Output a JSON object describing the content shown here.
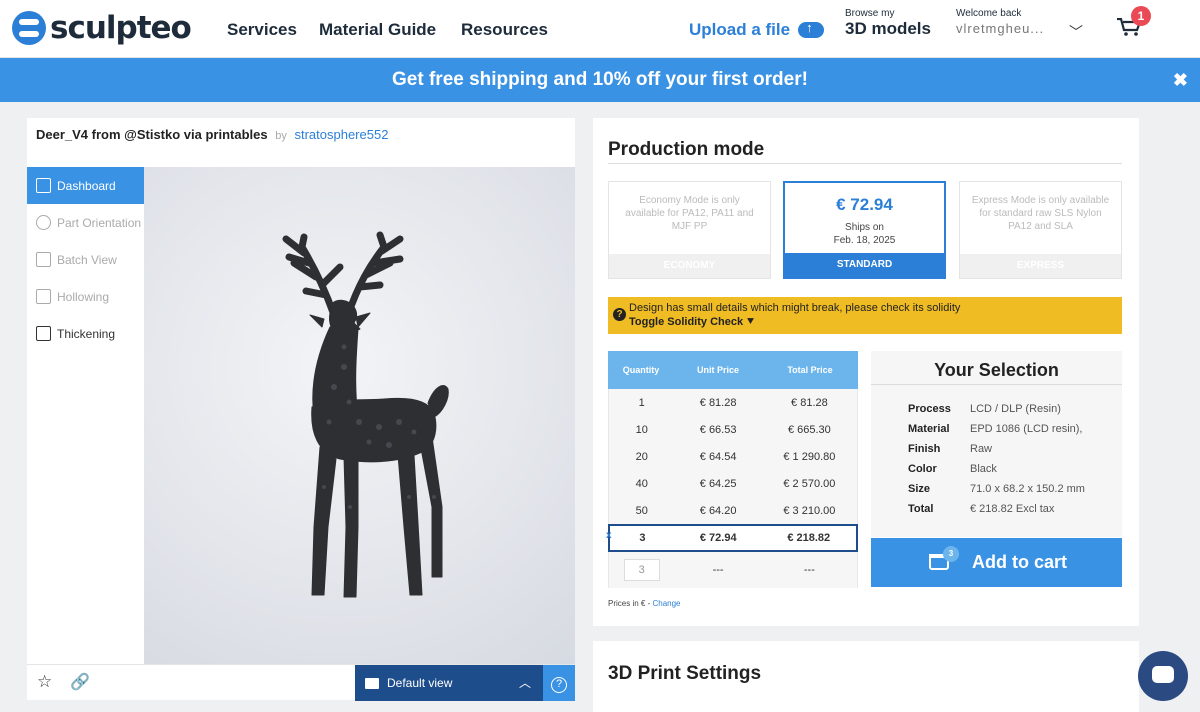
{
  "header": {
    "logo": "sculpteo",
    "nav": [
      "Services",
      "Material Guide",
      "Resources"
    ],
    "upload_label": "Upload a file",
    "browse_small": "Browse my",
    "browse_big": "3D models",
    "welcome_small": "Welcome back",
    "welcome_name": "vlretmgheu...",
    "cart_count": "1"
  },
  "promo": {
    "text": "Get free shipping and 10% off your first order!",
    "close": "✖"
  },
  "part": {
    "name": "Deer_V4 from @Stistko via printables",
    "by": "by",
    "user": "stratosphere552"
  },
  "sidebar": {
    "items": [
      {
        "label": "Dashboard"
      },
      {
        "label": "Part Orientation"
      },
      {
        "label": "Batch View"
      },
      {
        "label": "Hollowing"
      },
      {
        "label": "Thickening"
      }
    ]
  },
  "viewer": {
    "view_label": "Default view",
    "help": "?"
  },
  "production": {
    "title": "Production mode",
    "economy_text": "Economy Mode is only available for PA12, PA11 and MJF PP",
    "economy_label": "ECONOMY",
    "standard_price": "€ 72.94",
    "standard_ships": "Ships on",
    "standard_date": "Feb. 18, 2025",
    "standard_label": "STANDARD",
    "express_text": "Express Mode is only available for standard raw SLS Nylon PA12 and SLA",
    "express_label": "EXPRESS"
  },
  "warning": {
    "line1": "Design has small details which might break, please check its solidity",
    "line2": "Toggle Solidity Check ⯆"
  },
  "pricing": {
    "headers": [
      "Quantity",
      "Unit Price",
      "Total Price"
    ],
    "rows": [
      [
        "1",
        "€ 81.28",
        "€ 81.28"
      ],
      [
        "10",
        "€ 66.53",
        "€ 665.30"
      ],
      [
        "20",
        "€ 64.54",
        "€ 1 290.80"
      ],
      [
        "40",
        "€ 64.25",
        "€ 2 570.00"
      ],
      [
        "50",
        "€ 64.20",
        "€ 3 210.00"
      ]
    ],
    "selected": {
      "mark": "x",
      "qty": "3",
      "unit": "€ 72.94",
      "total": "€ 218.82"
    },
    "input_value": "3",
    "input_unit": "---",
    "input_total": "---",
    "prices_in": "Prices in € -",
    "change": "Change"
  },
  "selection": {
    "title": "Your Selection",
    "process_k": "Process",
    "process_v": "LCD / DLP (Resin)",
    "material_k": "Material",
    "material_v": "EPD 1086 (LCD resin),",
    "finish_k": "Finish",
    "finish_v": "Raw",
    "color_k": "Color",
    "color_v": "Black",
    "size_k": "Size",
    "size_v": "71.0 x 68.2 x 150.2 mm",
    "total_k": "Total",
    "total_v": "€ 218.82 Excl tax"
  },
  "add_to_cart": {
    "label": "Add to cart",
    "badge": "3"
  },
  "settings": {
    "title": "3D Print Settings"
  }
}
